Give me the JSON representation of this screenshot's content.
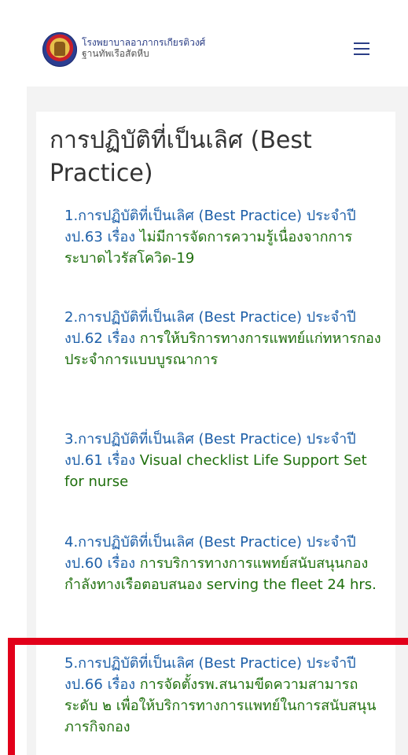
{
  "header": {
    "brand_line1": "โรงพยาบาลอาภากรเกียรติวงศ์",
    "brand_line2": "ฐานทัพเรือสัตหีบ",
    "logo_icon": "hospital-emblem-icon",
    "menu_icon": "hamburger-menu-icon"
  },
  "page": {
    "title": "การปฏิบัติที่เป็นเลิศ (Best Practice)"
  },
  "items": [
    {
      "lead": "1.การปฏิบัติที่เป็นเลิศ (Best Practice) ประจำปี งป.63 เรื่อง",
      "text": " ไม่มีการจัดการความรู้เนื่องจากการระบาดไวรัสโควิด-19"
    },
    {
      "lead": "2.การปฏิบัติที่เป็นเลิศ (Best Practice) ประจำปี งป.62  เรื่อง",
      "text": " การให้บริการทางการแพทย์แก่ทหารกองประจำการแบบบูรณาการ"
    },
    {
      "lead": "3.การปฏิบัติที่เป็นเลิศ (Best Practice) ประจำปี งป.61  เรื่อง",
      "text": " Visual checklist Life Support Set for nurse"
    },
    {
      "lead": "4.การปฏิบัติที่เป็นเลิศ (Best Practice) ประจำปี งป.60 เรื่อง",
      "text": " การบริการทางการแพทย์สนับสนุนกองกำลังทางเรือตอบสนอง serving the fleet 24 hrs."
    },
    {
      "lead": "5.การปฏิบัติที่เป็นเลิศ (Best Practice) ประจำปี งป.66 เรื่อง",
      "text": " การจัดตั้งรพ.สนามขีดความสามารถระดับ ๒ เพื่อให้บริการทางการแพทย์ในการสนับสนุนภารกิจกอง"
    }
  ],
  "colors": {
    "link_blue": "#1d5fa8",
    "text_green": "#1f6f0d",
    "highlight_red": "#e2001a"
  }
}
